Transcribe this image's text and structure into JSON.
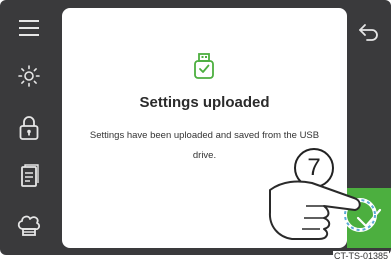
{
  "dialog": {
    "title": "Settings uploaded",
    "message": "Settings have been uploaded and saved from the USB drive.",
    "icon": "usb-drive-check-icon"
  },
  "sidebar": {
    "items": [
      {
        "icon": "menu-icon"
      },
      {
        "icon": "brightness-icon"
      },
      {
        "icon": "lock-icon"
      },
      {
        "icon": "recipe-book-icon"
      },
      {
        "icon": "chef-hat-icon"
      }
    ]
  },
  "actions": {
    "back_icon": "back-arrow-icon",
    "confirm_icon": "checkmark-icon"
  },
  "annotation": {
    "step_number": "7"
  },
  "document_code": "CT-TS-01385",
  "colors": {
    "screen_background": "#3a3a3c",
    "accent_green": "#4caf3f",
    "dialog_background": "#ffffff"
  }
}
